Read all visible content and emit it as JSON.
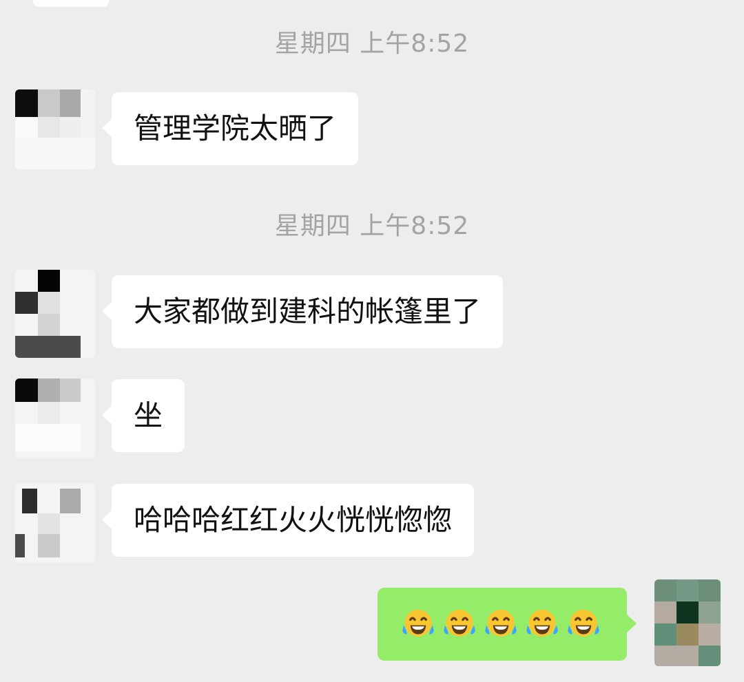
{
  "chat": {
    "time_1": "星期四 上午8:52",
    "time_2": "星期四 上午8:52",
    "messages": [
      {
        "text": "管理学院太晒了"
      },
      {
        "text": "大家都做到建科的帐篷里了"
      },
      {
        "text": "坐"
      },
      {
        "text": "哈哈哈红红火火恍恍惚惚"
      }
    ],
    "self_message": {
      "emoji_name": "tears-of-joy-emoji",
      "emoji_count": 5
    }
  },
  "colors": {
    "background": "#ededed",
    "incoming_bubble": "#ffffff",
    "outgoing_bubble": "#95ec69",
    "timestamp_text": "#a3a3a3",
    "message_text": "#111111"
  }
}
